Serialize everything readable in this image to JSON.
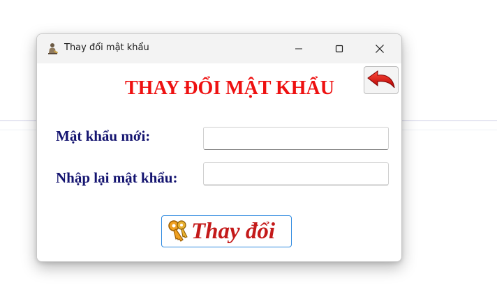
{
  "window": {
    "title": "Thay đổi mật khẩu",
    "icon": "user-icon",
    "controls": [
      "minimize-icon",
      "maximize-icon",
      "close-icon"
    ]
  },
  "form": {
    "heading": "THAY ĐỔI MẬT KHẨU",
    "back_icon": "back-arrow-icon",
    "new_password_label": "Mật khẩu mới:",
    "new_password_value": "",
    "confirm_password_label": "Nhập lại mật khẩu:",
    "confirm_password_value": "",
    "submit_label": "Thay đổi",
    "submit_icon": "keys-icon"
  },
  "colors": {
    "heading": "#ee1111",
    "label": "#141470",
    "submit_text": "#c41a1a",
    "submit_border": "#2f8ae0"
  }
}
